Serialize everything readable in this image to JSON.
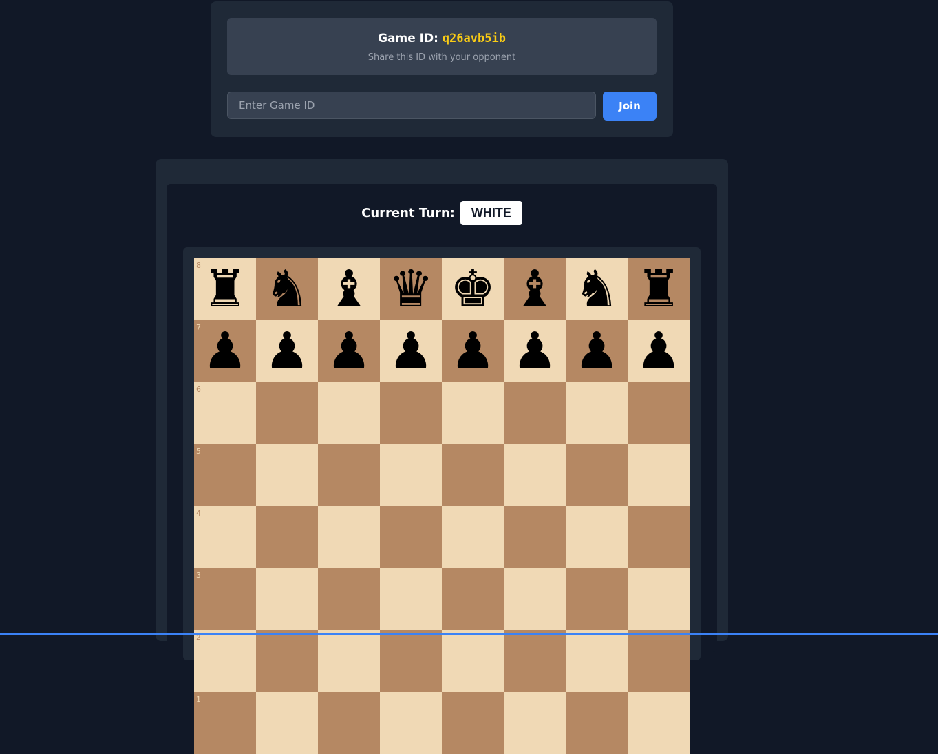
{
  "lobby": {
    "game_id_label": "Game ID:",
    "game_id_value": "q26avb5ib",
    "share_text": "Share this ID with your opponent",
    "join_placeholder": "Enter Game ID",
    "join_value": "",
    "join_button": "Join"
  },
  "turn": {
    "label": "Current Turn:",
    "value": "WHITE"
  },
  "board": {
    "colors": {
      "light": "#f0d9b5",
      "dark": "#b58863"
    },
    "ranks": [
      {
        "rank": "8",
        "pieces": [
          "black-rook",
          "black-knight",
          "black-bishop",
          "black-queen",
          "black-king",
          "black-bishop",
          "black-knight",
          "black-rook"
        ]
      },
      {
        "rank": "7",
        "pieces": [
          "black-pawn",
          "black-pawn",
          "black-pawn",
          "black-pawn",
          "black-pawn",
          "black-pawn",
          "black-pawn",
          "black-pawn"
        ]
      },
      {
        "rank": "6",
        "pieces": [
          "",
          "",
          "",
          "",
          "",
          "",
          "",
          ""
        ]
      },
      {
        "rank": "5",
        "pieces": [
          "",
          "",
          "",
          "",
          "",
          "",
          "",
          ""
        ]
      },
      {
        "rank": "4",
        "pieces": [
          "",
          "",
          "",
          "",
          "",
          "",
          "",
          ""
        ]
      },
      {
        "rank": "3",
        "pieces": [
          "",
          "",
          "",
          "",
          "",
          "",
          "",
          ""
        ]
      },
      {
        "rank": "2",
        "pieces": [
          "",
          "",
          "",
          "",
          "",
          "",
          "",
          ""
        ]
      },
      {
        "rank": "1",
        "pieces": [
          "",
          "",
          "",
          "",
          "",
          "",
          "",
          ""
        ]
      }
    ]
  }
}
